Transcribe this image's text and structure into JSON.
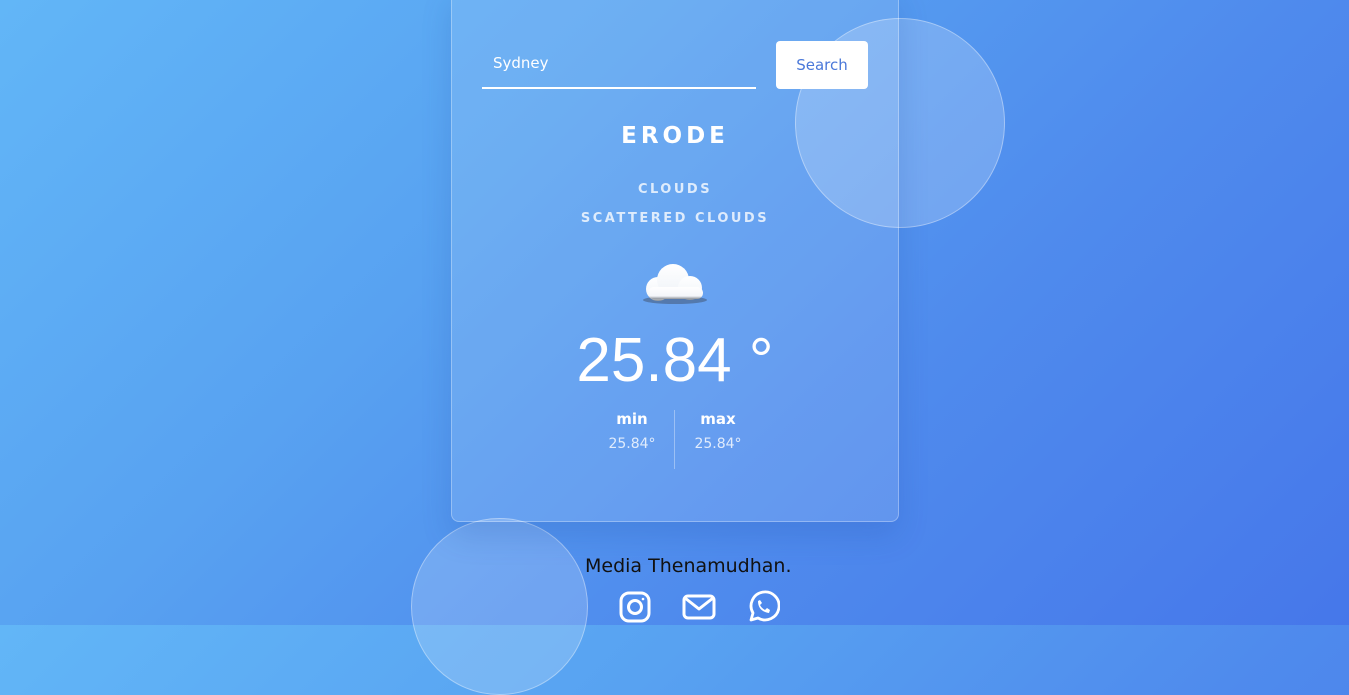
{
  "search": {
    "value": "Sydney",
    "button_label": "Search"
  },
  "weather": {
    "city": "ERODE",
    "condition": "CLOUDS",
    "description": "SCATTERED CLOUDS",
    "icon": "cloud-icon",
    "temperature": "25.84 °",
    "min_label": "min",
    "min_value": "25.84°",
    "max_label": "max",
    "max_value": "25.84°"
  },
  "footer": {
    "text": "Media Thenamudhan.",
    "social_icons": [
      "instagram-icon",
      "mail-icon",
      "whatsapp-icon"
    ]
  },
  "colors": {
    "background_start": "#62b6f7",
    "background_end": "#4677ea",
    "button_text": "#4a78d9",
    "text": "#ffffff"
  }
}
